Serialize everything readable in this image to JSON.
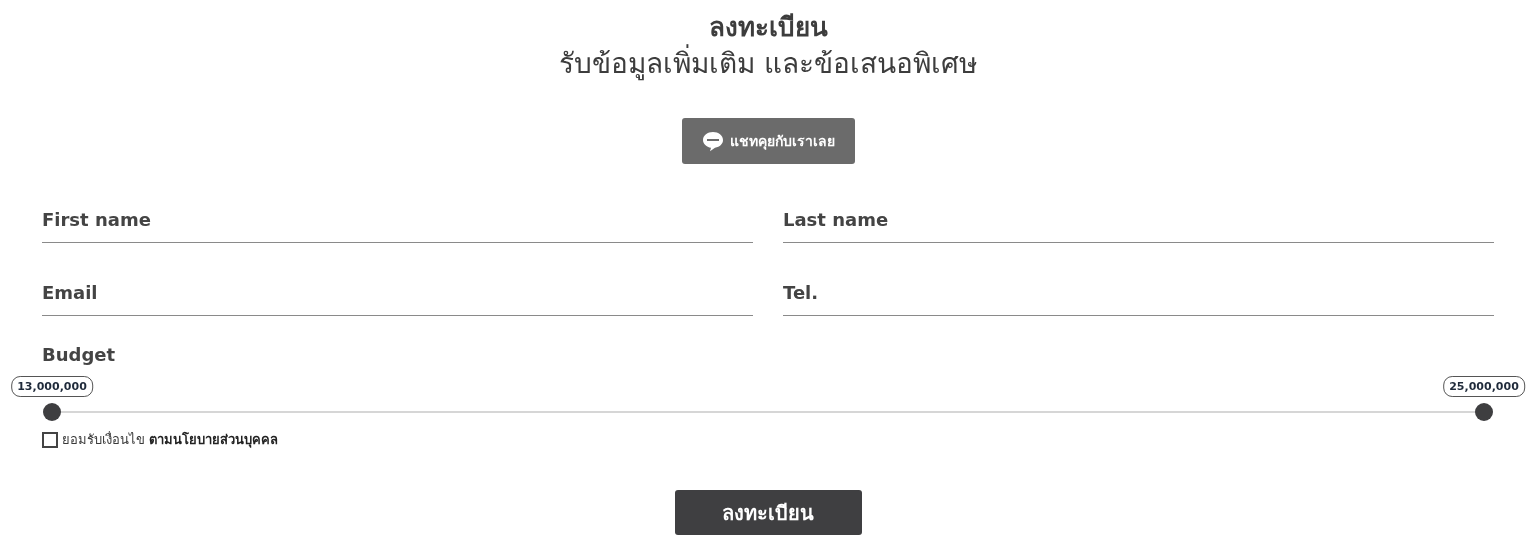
{
  "heading": {
    "title": "ลงทะเบียน",
    "subtitle": "รับข้อมูลเพิ่มเติม และข้อเสนอพิเศษ"
  },
  "line_button": {
    "label": "แชทคุยกับเราเลย"
  },
  "fields": [
    {
      "placeholder": "First name"
    },
    {
      "placeholder": "Last name"
    },
    {
      "placeholder": "Email"
    },
    {
      "placeholder": "Tel."
    }
  ],
  "budget": {
    "label": "Budget",
    "handles": [
      {
        "level": 0,
        "reading": "13,000,000"
      },
      {
        "level": 1,
        "reading": "25,000,000"
      }
    ]
  },
  "consent": {
    "checked": false,
    "text": "ยอมรับเงื่อนไข",
    "link": "ตามนโยบายส่วนบุคคล"
  },
  "submit": {
    "label": "ลงทะเบียน"
  }
}
